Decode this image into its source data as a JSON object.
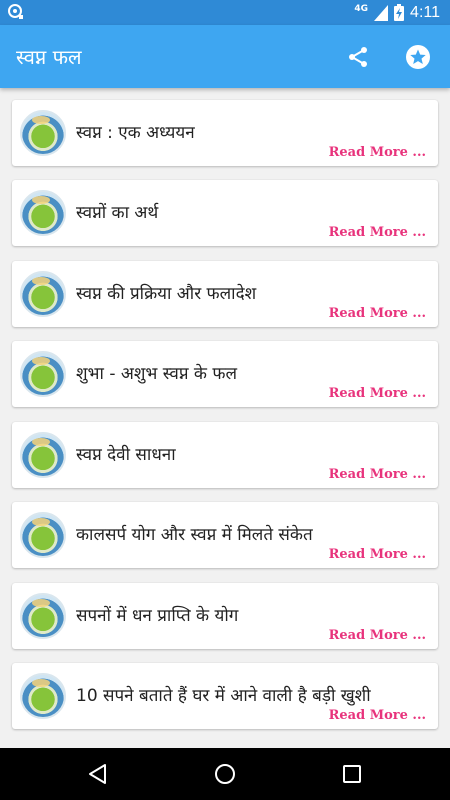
{
  "status_bar": {
    "network": "4G",
    "time": "4:11"
  },
  "app_bar": {
    "title": "स्वप्न फल"
  },
  "items": [
    {
      "title": "स्वप्न : एक अध्ययन",
      "more": "Read More ..."
    },
    {
      "title": "स्वप्नों का अर्थ",
      "more": "Read More ..."
    },
    {
      "title": "स्वप्न की प्रक्रिया और फलादेश",
      "more": "Read More ..."
    },
    {
      "title": "शुभा - अशुभ स्वप्न के फल",
      "more": "Read More ..."
    },
    {
      "title": "स्वप्न देवी साधना",
      "more": "Read More ..."
    },
    {
      "title": "कालसर्प योग और स्वप्न में मिलते संकेत",
      "more": "Read More ..."
    },
    {
      "title": "सपनों में धन प्राप्ति के योग",
      "more": "Read More ..."
    },
    {
      "title": "10 सपने बताते हैं घर में आने वाली है बड़ी खुशी",
      "more": "Read More ..."
    }
  ],
  "colors": {
    "status_bar": "#2f8ad6",
    "app_bar": "#3ea6f1",
    "read_more": "#e8337c"
  }
}
